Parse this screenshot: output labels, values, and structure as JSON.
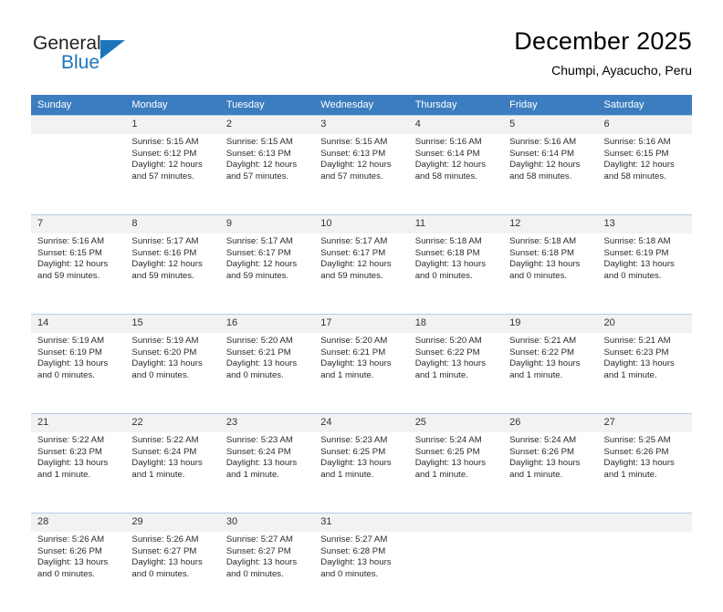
{
  "logo": {
    "word_top": "General",
    "word_bottom": "Blue",
    "accent_color": "#1b75bb"
  },
  "header": {
    "title": "December 2025",
    "subtitle": "Chumpi, Ayacucho, Peru"
  },
  "theme": {
    "header_row_bg": "#3c7dc0",
    "header_row_text": "#ffffff",
    "daynum_bg": "#f2f2f2",
    "grid_line": "#b9cde5"
  },
  "weekday_headers": [
    "Sunday",
    "Monday",
    "Tuesday",
    "Wednesday",
    "Thursday",
    "Friday",
    "Saturday"
  ],
  "weeks": [
    [
      {
        "day": "",
        "lines": [
          "",
          "",
          "",
          ""
        ]
      },
      {
        "day": "1",
        "lines": [
          "Sunrise: 5:15 AM",
          "Sunset: 6:12 PM",
          "Daylight: 12 hours",
          "and 57 minutes."
        ]
      },
      {
        "day": "2",
        "lines": [
          "Sunrise: 5:15 AM",
          "Sunset: 6:13 PM",
          "Daylight: 12 hours",
          "and 57 minutes."
        ]
      },
      {
        "day": "3",
        "lines": [
          "Sunrise: 5:15 AM",
          "Sunset: 6:13 PM",
          "Daylight: 12 hours",
          "and 57 minutes."
        ]
      },
      {
        "day": "4",
        "lines": [
          "Sunrise: 5:16 AM",
          "Sunset: 6:14 PM",
          "Daylight: 12 hours",
          "and 58 minutes."
        ]
      },
      {
        "day": "5",
        "lines": [
          "Sunrise: 5:16 AM",
          "Sunset: 6:14 PM",
          "Daylight: 12 hours",
          "and 58 minutes."
        ]
      },
      {
        "day": "6",
        "lines": [
          "Sunrise: 5:16 AM",
          "Sunset: 6:15 PM",
          "Daylight: 12 hours",
          "and 58 minutes."
        ]
      }
    ],
    [
      {
        "day": "7",
        "lines": [
          "Sunrise: 5:16 AM",
          "Sunset: 6:15 PM",
          "Daylight: 12 hours",
          "and 59 minutes."
        ]
      },
      {
        "day": "8",
        "lines": [
          "Sunrise: 5:17 AM",
          "Sunset: 6:16 PM",
          "Daylight: 12 hours",
          "and 59 minutes."
        ]
      },
      {
        "day": "9",
        "lines": [
          "Sunrise: 5:17 AM",
          "Sunset: 6:17 PM",
          "Daylight: 12 hours",
          "and 59 minutes."
        ]
      },
      {
        "day": "10",
        "lines": [
          "Sunrise: 5:17 AM",
          "Sunset: 6:17 PM",
          "Daylight: 12 hours",
          "and 59 minutes."
        ]
      },
      {
        "day": "11",
        "lines": [
          "Sunrise: 5:18 AM",
          "Sunset: 6:18 PM",
          "Daylight: 13 hours",
          "and 0 minutes."
        ]
      },
      {
        "day": "12",
        "lines": [
          "Sunrise: 5:18 AM",
          "Sunset: 6:18 PM",
          "Daylight: 13 hours",
          "and 0 minutes."
        ]
      },
      {
        "day": "13",
        "lines": [
          "Sunrise: 5:18 AM",
          "Sunset: 6:19 PM",
          "Daylight: 13 hours",
          "and 0 minutes."
        ]
      }
    ],
    [
      {
        "day": "14",
        "lines": [
          "Sunrise: 5:19 AM",
          "Sunset: 6:19 PM",
          "Daylight: 13 hours",
          "and 0 minutes."
        ]
      },
      {
        "day": "15",
        "lines": [
          "Sunrise: 5:19 AM",
          "Sunset: 6:20 PM",
          "Daylight: 13 hours",
          "and 0 minutes."
        ]
      },
      {
        "day": "16",
        "lines": [
          "Sunrise: 5:20 AM",
          "Sunset: 6:21 PM",
          "Daylight: 13 hours",
          "and 0 minutes."
        ]
      },
      {
        "day": "17",
        "lines": [
          "Sunrise: 5:20 AM",
          "Sunset: 6:21 PM",
          "Daylight: 13 hours",
          "and 1 minute."
        ]
      },
      {
        "day": "18",
        "lines": [
          "Sunrise: 5:20 AM",
          "Sunset: 6:22 PM",
          "Daylight: 13 hours",
          "and 1 minute."
        ]
      },
      {
        "day": "19",
        "lines": [
          "Sunrise: 5:21 AM",
          "Sunset: 6:22 PM",
          "Daylight: 13 hours",
          "and 1 minute."
        ]
      },
      {
        "day": "20",
        "lines": [
          "Sunrise: 5:21 AM",
          "Sunset: 6:23 PM",
          "Daylight: 13 hours",
          "and 1 minute."
        ]
      }
    ],
    [
      {
        "day": "21",
        "lines": [
          "Sunrise: 5:22 AM",
          "Sunset: 6:23 PM",
          "Daylight: 13 hours",
          "and 1 minute."
        ]
      },
      {
        "day": "22",
        "lines": [
          "Sunrise: 5:22 AM",
          "Sunset: 6:24 PM",
          "Daylight: 13 hours",
          "and 1 minute."
        ]
      },
      {
        "day": "23",
        "lines": [
          "Sunrise: 5:23 AM",
          "Sunset: 6:24 PM",
          "Daylight: 13 hours",
          "and 1 minute."
        ]
      },
      {
        "day": "24",
        "lines": [
          "Sunrise: 5:23 AM",
          "Sunset: 6:25 PM",
          "Daylight: 13 hours",
          "and 1 minute."
        ]
      },
      {
        "day": "25",
        "lines": [
          "Sunrise: 5:24 AM",
          "Sunset: 6:25 PM",
          "Daylight: 13 hours",
          "and 1 minute."
        ]
      },
      {
        "day": "26",
        "lines": [
          "Sunrise: 5:24 AM",
          "Sunset: 6:26 PM",
          "Daylight: 13 hours",
          "and 1 minute."
        ]
      },
      {
        "day": "27",
        "lines": [
          "Sunrise: 5:25 AM",
          "Sunset: 6:26 PM",
          "Daylight: 13 hours",
          "and 1 minute."
        ]
      }
    ],
    [
      {
        "day": "28",
        "lines": [
          "Sunrise: 5:26 AM",
          "Sunset: 6:26 PM",
          "Daylight: 13 hours",
          "and 0 minutes."
        ]
      },
      {
        "day": "29",
        "lines": [
          "Sunrise: 5:26 AM",
          "Sunset: 6:27 PM",
          "Daylight: 13 hours",
          "and 0 minutes."
        ]
      },
      {
        "day": "30",
        "lines": [
          "Sunrise: 5:27 AM",
          "Sunset: 6:27 PM",
          "Daylight: 13 hours",
          "and 0 minutes."
        ]
      },
      {
        "day": "31",
        "lines": [
          "Sunrise: 5:27 AM",
          "Sunset: 6:28 PM",
          "Daylight: 13 hours",
          "and 0 minutes."
        ]
      },
      {
        "day": "",
        "lines": [
          "",
          "",
          "",
          ""
        ]
      },
      {
        "day": "",
        "lines": [
          "",
          "",
          "",
          ""
        ]
      },
      {
        "day": "",
        "lines": [
          "",
          "",
          "",
          ""
        ]
      }
    ]
  ]
}
